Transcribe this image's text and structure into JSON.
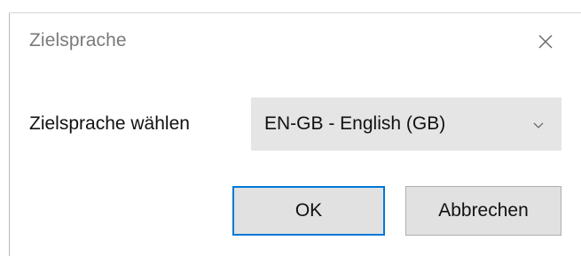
{
  "dialog": {
    "title": "Zielsprache",
    "close_icon": "close-icon"
  },
  "form": {
    "label": "Zielsprache wählen",
    "select_value": "EN-GB - English (GB)",
    "select_arrow_icon": "chevron-down-icon"
  },
  "buttons": {
    "ok_label": "OK",
    "cancel_label": "Abbrechen"
  },
  "colors": {
    "accent": "#0078d7",
    "button_bg": "#e1e1e1",
    "select_bg": "#e5e5e5"
  }
}
